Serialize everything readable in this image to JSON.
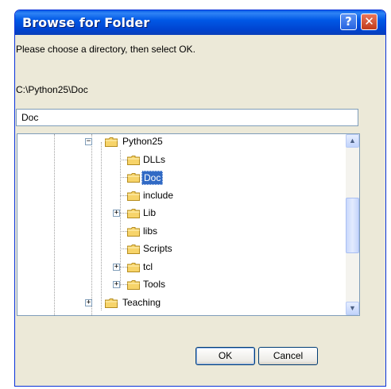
{
  "window": {
    "title": "Browse for Folder",
    "help_glyph": "?",
    "close_glyph": "✕"
  },
  "prompt_text": "Please choose a directory, then select OK.",
  "current_path": "C:\\Python25\\Doc",
  "folder_name_value": "Doc",
  "tree": {
    "parent": {
      "label": "Python25",
      "expander": "−"
    },
    "children": [
      {
        "label": "DLLs",
        "expander": ""
      },
      {
        "label": "Doc",
        "expander": "",
        "selected": true
      },
      {
        "label": "include",
        "expander": ""
      },
      {
        "label": "Lib",
        "expander": "+"
      },
      {
        "label": "libs",
        "expander": ""
      },
      {
        "label": "Scripts",
        "expander": ""
      },
      {
        "label": "tcl",
        "expander": "+"
      },
      {
        "label": "Tools",
        "expander": "+"
      }
    ],
    "next_sibling": {
      "label": "Teaching",
      "expander": "+"
    }
  },
  "scroll_arrows": {
    "up": "▲",
    "down": "▼"
  },
  "buttons": {
    "ok": "OK",
    "cancel": "Cancel"
  },
  "colors": {
    "titlebar": "#0058e6",
    "selection": "#316ac5",
    "dialog_face": "#ece9d8"
  }
}
